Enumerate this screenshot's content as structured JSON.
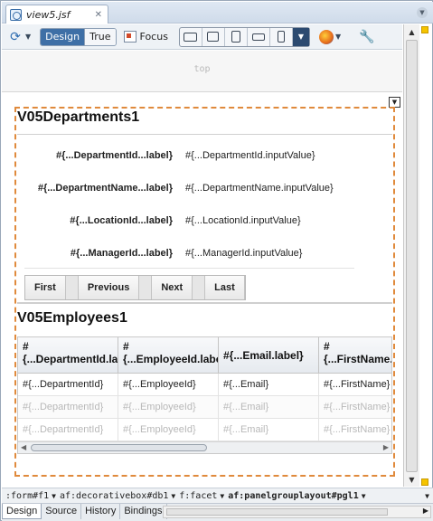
{
  "tab": {
    "title": "view5.jsf",
    "close": "✕"
  },
  "toolbar": {
    "design": "Design",
    "true": "True",
    "focus": "Focus"
  },
  "canvas": {
    "top_facet": "top"
  },
  "departments": {
    "title": "V05Departments1",
    "fields": [
      {
        "label": "#{...DepartmentId...label}",
        "value": "#{...DepartmentId.inputValue}"
      },
      {
        "label": "#{...DepartmentName...label}",
        "value": "#{...DepartmentName.inputValue}"
      },
      {
        "label": "#{...LocationId...label}",
        "value": "#{...LocationId.inputValue}"
      },
      {
        "label": "#{...ManagerId...label}",
        "value": "#{...ManagerId.inputValue}"
      }
    ],
    "nav": {
      "first": "First",
      "previous": "Previous",
      "next": "Next",
      "last": "Last"
    }
  },
  "employees": {
    "title": "V05Employees1",
    "headers": [
      {
        "line1": "#",
        "line2": "{...DepartmentId.label}"
      },
      {
        "line1": "#",
        "line2": "{...EmployeeId.label}"
      },
      {
        "line1": "#{...Email.label}",
        "line2": ""
      },
      {
        "line1": "#",
        "line2": "{...FirstName.label}"
      }
    ],
    "rows": [
      [
        "#{...DepartmentId}",
        "#{...EmployeeId}",
        "#{...Email}",
        "#{...FirstName}"
      ],
      [
        "#{...DepartmentId}",
        "#{...EmployeeId}",
        "#{...Email}",
        "#{...FirstName}"
      ],
      [
        "#{...DepartmentId}",
        "#{...EmployeeId}",
        "#{...Email}",
        "#{...FirstName}"
      ]
    ]
  },
  "breadcrumbs": [
    ":form#f1",
    "af:decorativebox#db1",
    "f:facet",
    "af:panelgrouplayout#pgl1"
  ],
  "bottom_tabs": [
    "Design",
    "Source",
    "History",
    "Bindings"
  ],
  "colors": {
    "accent": "#3e6fa6",
    "dashed": "#e08a3c",
    "marker": "#f5c400"
  }
}
